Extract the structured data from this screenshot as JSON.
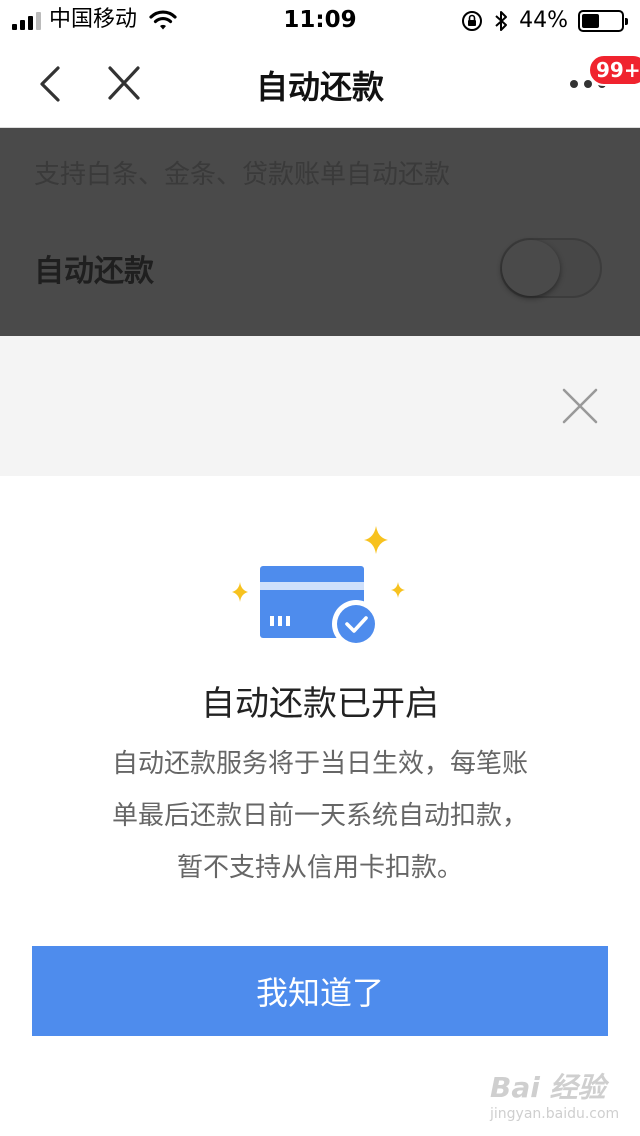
{
  "status_bar": {
    "carrier": "中国移动",
    "time": "11:09",
    "battery_percent": "44%",
    "battery_level": 0.44
  },
  "nav": {
    "title": "自动还款",
    "badge": "99+"
  },
  "page": {
    "subtitle": "支持白条、金条、贷款账单自动还款",
    "auto_repay_label": "自动还款",
    "auto_repay_enabled": false
  },
  "dialog": {
    "title": "自动还款已开启",
    "body": "自动还款服务将于当日生效，每笔账单最后还款日前一天系统自动扣款，暂不支持从信用卡扣款。",
    "confirm_label": "我知道了"
  },
  "watermark": {
    "text": "Bai 经验",
    "url": "jingyan.baidu.com"
  },
  "colors": {
    "accent": "#4e8ced",
    "badge": "#f0232e",
    "sparkle": "#f7c21f"
  }
}
